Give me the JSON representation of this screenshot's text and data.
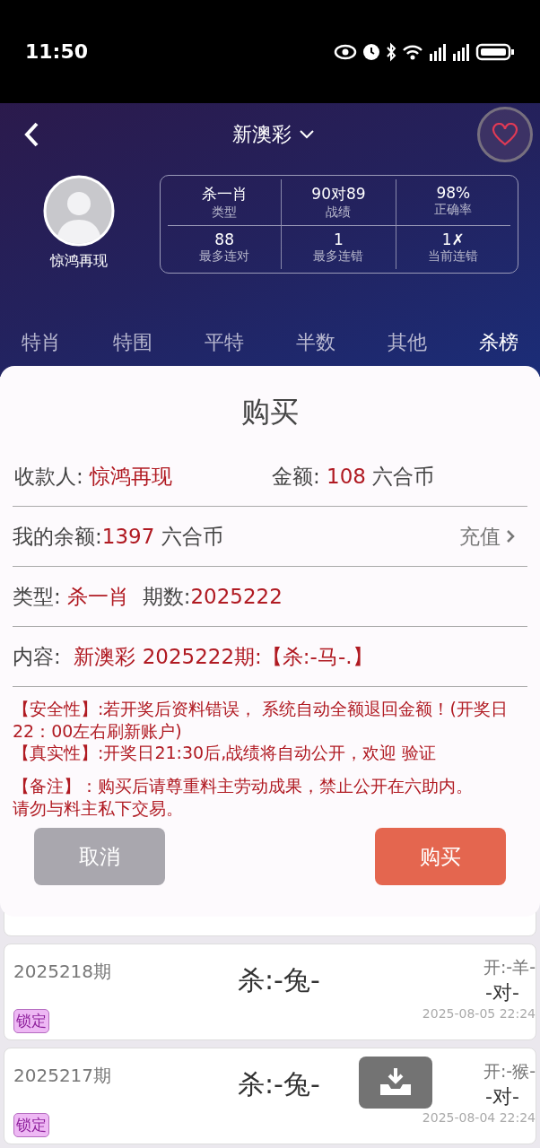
{
  "status_bar": {
    "time": "11:50"
  },
  "header": {
    "title": "新澳彩",
    "username": "惊鸿再现",
    "stats": [
      {
        "value": "杀一肖",
        "label": "类型"
      },
      {
        "value": "90对89",
        "label": "战绩"
      },
      {
        "value": "98%",
        "label": "正确率"
      },
      {
        "value": "88",
        "label": "最多连对"
      },
      {
        "value": "1",
        "label": "最多连错"
      },
      {
        "value": "1✗",
        "label": "当前连错"
      }
    ],
    "tabs": [
      {
        "label": "特肖",
        "selected": false
      },
      {
        "label": "特围",
        "selected": false
      },
      {
        "label": "平特",
        "selected": false
      },
      {
        "label": "半数",
        "selected": false
      },
      {
        "label": "其他",
        "selected": false
      },
      {
        "label": "杀榜",
        "selected": true
      }
    ]
  },
  "dialog": {
    "title": "购买",
    "payee_label": "收款人:",
    "payee": "惊鸿再现",
    "amount_label": "金额:",
    "amount": "108",
    "amount_unit": "六合币",
    "balance_label": "我的余额:",
    "balance": "1397",
    "balance_unit": "六合币",
    "recharge": "充值",
    "type_label": "类型:",
    "type": "杀一肖",
    "period_label": "期数:",
    "period": "2025222",
    "content_label": "内容:",
    "content": "新澳彩 2025222期:【杀:-马-.】",
    "notes": [
      "【安全性】:若开奖后资料错误， 系统自动全额退回金额！(开奖日22：00左右刷新账户)",
      "【真实性】:开奖日21:30后,战绩将自动公开，欢迎 验证",
      "【备注】：购买后请尊重料主劳动成果，禁止公开在六助内。",
      "请勿与料主私下交易。"
    ],
    "cancel": "取消",
    "confirm": "购买"
  },
  "records": [
    {
      "period": "2025218期",
      "kill": "杀:-兔-",
      "open": "开:-羊-",
      "result": "-对-",
      "time": "2025-08-05 22:24",
      "badge": "锁定"
    },
    {
      "period": "2025217期",
      "kill": "杀:-兔-",
      "open": "开:-猴-",
      "result": "-对-",
      "time": "2025-08-04 22:24",
      "badge": "锁定"
    }
  ]
}
